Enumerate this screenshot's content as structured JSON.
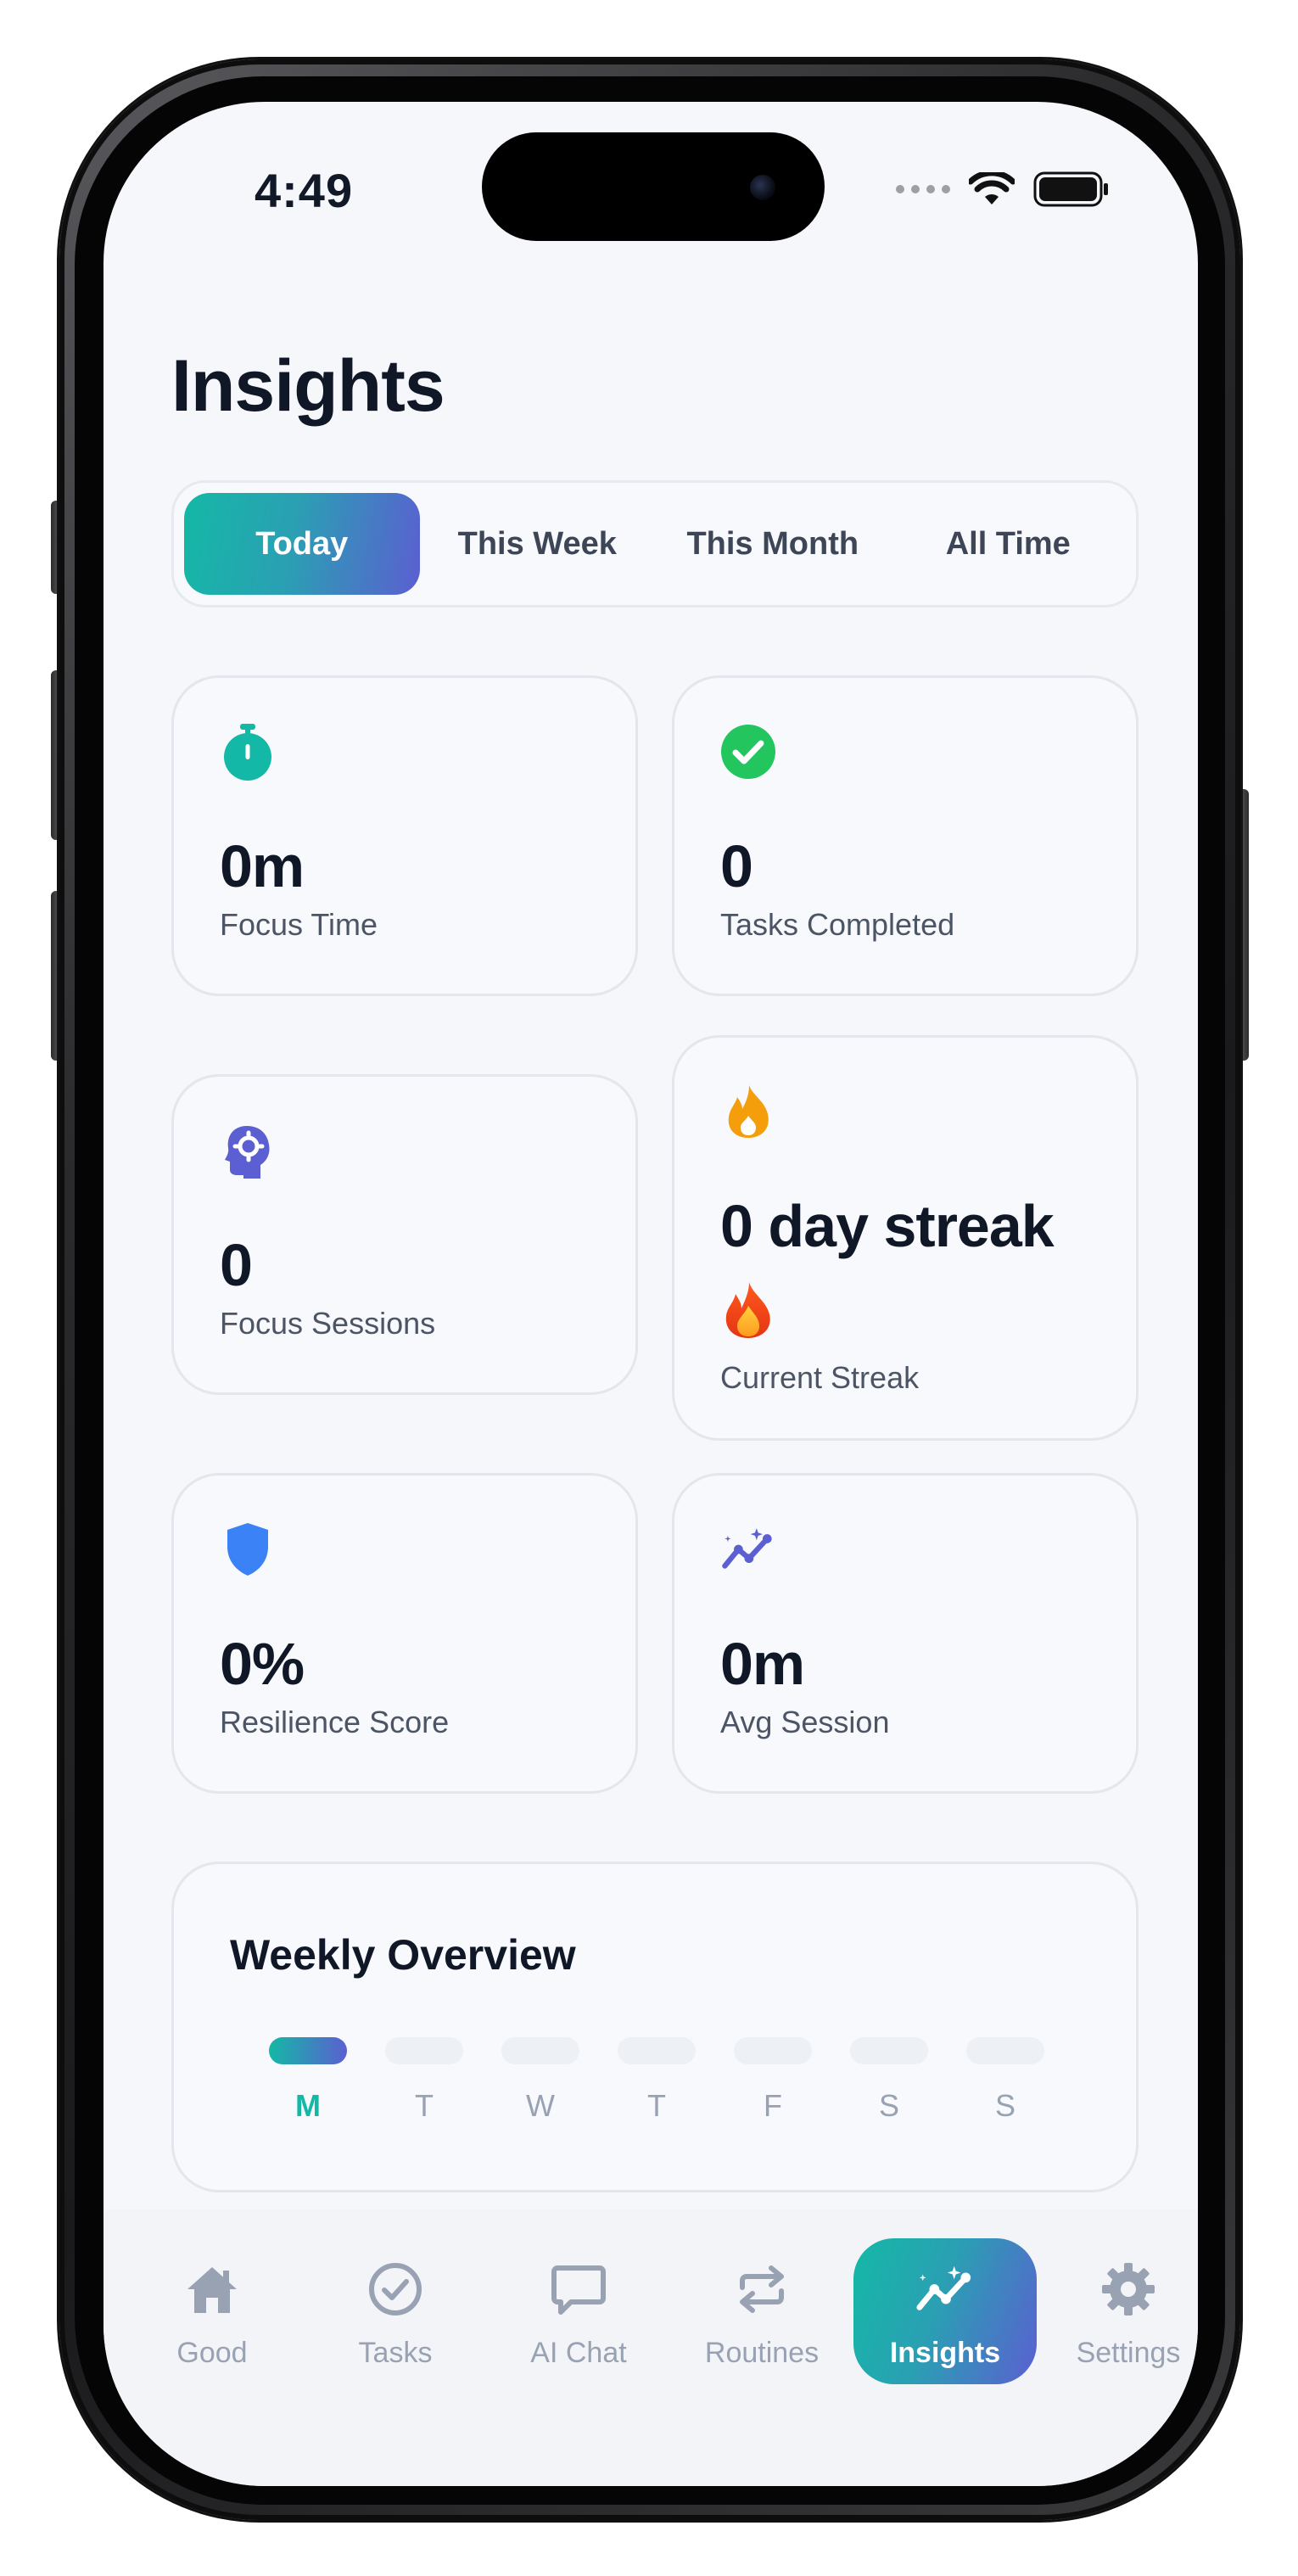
{
  "status_bar": {
    "time": "4:49"
  },
  "header": {
    "title": "Insights"
  },
  "period_tabs": [
    {
      "label": "Today",
      "active": true
    },
    {
      "label": "This Week",
      "active": false
    },
    {
      "label": "This Month",
      "active": false
    },
    {
      "label": "All Time",
      "active": false
    }
  ],
  "stats": {
    "focus_time": {
      "value": "0m",
      "label": "Focus Time",
      "icon": "stopwatch-icon",
      "color": "#14b8a6"
    },
    "tasks_completed": {
      "value": "0",
      "label": "Tasks Completed",
      "icon": "check-circle-icon",
      "color": "#22c55e"
    },
    "focus_sessions": {
      "value": "0",
      "label": "Focus Sessions",
      "icon": "brain-gear-icon",
      "color": "#5b5fd1"
    },
    "current_streak": {
      "value": "0 day streak",
      "label": "Current Streak",
      "icon": "flame-icon",
      "color": "#f59e0b"
    },
    "resilience_score": {
      "value": "0%",
      "label": "Resilience Score",
      "icon": "shield-icon",
      "color": "#3b82f6"
    },
    "avg_session": {
      "value": "0m",
      "label": "Avg Session",
      "icon": "sparkle-chart-icon",
      "color": "#5b5fd1"
    }
  },
  "weekly_overview": {
    "title": "Weekly Overview",
    "days": [
      {
        "label": "M",
        "active": true
      },
      {
        "label": "T",
        "active": false
      },
      {
        "label": "W",
        "active": false
      },
      {
        "label": "T",
        "active": false
      },
      {
        "label": "F",
        "active": false
      },
      {
        "label": "S",
        "active": false
      },
      {
        "label": "S",
        "active": false
      }
    ]
  },
  "bottom_nav": [
    {
      "label": "Good",
      "icon": "home-icon",
      "active": false
    },
    {
      "label": "Tasks",
      "icon": "check-circle-outline-icon",
      "active": false
    },
    {
      "label": "AI Chat",
      "icon": "chat-bubble-icon",
      "active": false
    },
    {
      "label": "Routines",
      "icon": "repeat-icon",
      "active": false
    },
    {
      "label": "Insights",
      "icon": "sparkle-chart-icon",
      "active": true
    },
    {
      "label": "Settings",
      "icon": "gear-icon",
      "active": false
    }
  ],
  "theme": {
    "accent_start": "#14b8a6",
    "accent_end": "#5b5fd1",
    "background": "#f6f7fb"
  }
}
